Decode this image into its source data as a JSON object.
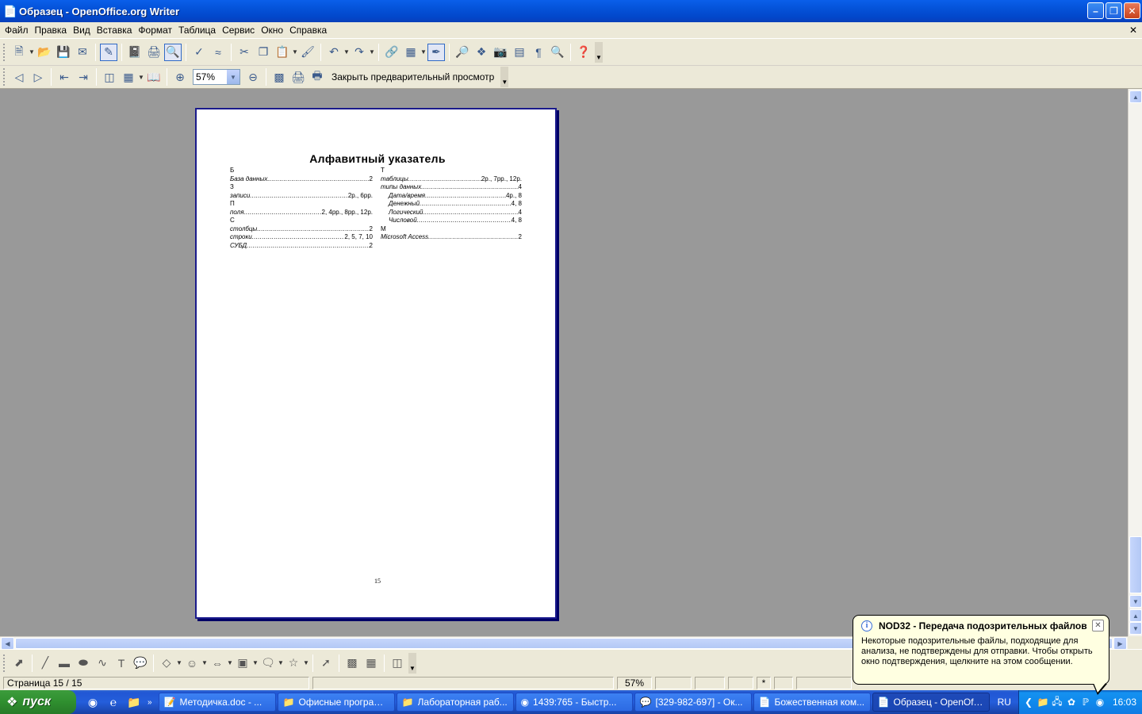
{
  "window": {
    "title": "Образец - OpenOffice.org Writer"
  },
  "menu": [
    "Файл",
    "Правка",
    "Вид",
    "Вставка",
    "Формат",
    "Таблица",
    "Сервис",
    "Окно",
    "Справка"
  ],
  "preview_toolbar": {
    "zoom_value": "57%",
    "close_preview_label": "Закрыть предварительный просмотр"
  },
  "document": {
    "title": "Алфавитный указатель",
    "page_number": "15",
    "index_left": [
      {
        "kind": "letter",
        "text": "Б"
      },
      {
        "kind": "entry",
        "text": "База данных",
        "pages": "2"
      },
      {
        "kind": "letter",
        "text": "З"
      },
      {
        "kind": "entry",
        "text": "записи",
        "pages": "2р., 6рр."
      },
      {
        "kind": "letter",
        "text": "П"
      },
      {
        "kind": "entry",
        "text": "поля",
        "pages": "2, 4рр., 8рр., 12р."
      },
      {
        "kind": "letter",
        "text": "С"
      },
      {
        "kind": "entry",
        "text": "столбцы",
        "pages": "2"
      },
      {
        "kind": "entry",
        "text": "строки",
        "pages": "2, 5, 7, 10"
      },
      {
        "kind": "entry",
        "text": "СУБД",
        "pages": "2"
      }
    ],
    "index_right": [
      {
        "kind": "letter",
        "text": "Т"
      },
      {
        "kind": "entry",
        "text": "таблицы",
        "pages": "2р., 7рр., 12р."
      },
      {
        "kind": "entry",
        "text": "типы данных",
        "pages": "4"
      },
      {
        "kind": "sub",
        "text": "Дата/время",
        "pages": "4р., 8"
      },
      {
        "kind": "sub",
        "text": "Денежный",
        "pages": "4, 8"
      },
      {
        "kind": "sub",
        "text": "Логический",
        "pages": "4"
      },
      {
        "kind": "sub",
        "text": "Числовой",
        "pages": "4, 8"
      },
      {
        "kind": "letter",
        "text": "M"
      },
      {
        "kind": "entry",
        "text": "Microsoft Access",
        "pages": "2"
      }
    ]
  },
  "statusbar": {
    "page": "Страница  15 / 15",
    "zoom": "57%",
    "modified": "*"
  },
  "taskbar": {
    "start_label": "пуск",
    "tasks": [
      {
        "icon": "word-icon",
        "label": "Методичка.doc - ..."
      },
      {
        "icon": "folder-icon",
        "label": "Офисные программы"
      },
      {
        "icon": "folder-icon",
        "label": "Лабораторная раб..."
      },
      {
        "icon": "opera-icon",
        "label": "1439:765 - Быстр..."
      },
      {
        "icon": "chat-icon",
        "label": "[329-982-697] - Ок..."
      },
      {
        "icon": "writer-icon",
        "label": "Божественная ком..."
      },
      {
        "icon": "writer-icon",
        "label": "Образец - OpenOff..."
      }
    ],
    "language": "RU",
    "clock": "16:03"
  },
  "balloon": {
    "title": "NOD32 - Передача подозрительных файлов",
    "text": "Некоторые подозрительные файлы, подходящие для анализа, не подтверждены для отправки. Чтобы открыть окно подтверждения, щелкните на этом сообщении."
  }
}
